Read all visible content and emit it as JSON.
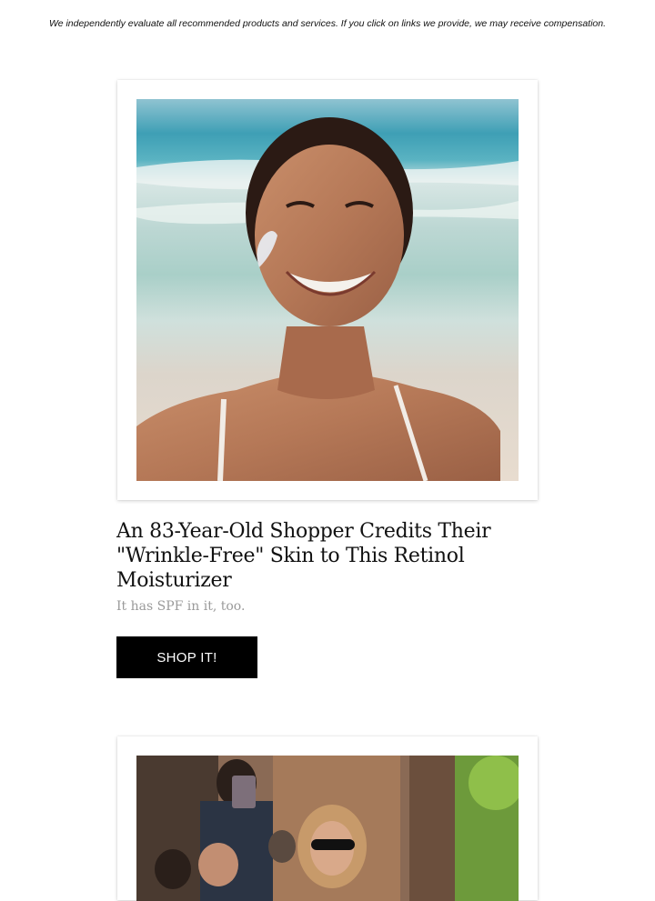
{
  "disclaimer": "We independently evaluate all recommended products and services. If you click on links we provide, we may receive compensation.",
  "articles": [
    {
      "headline": "An 83-Year-Old Shopper Credits Their \"Wrinkle-Free\" Skin to This Retinol Moisturizer",
      "subhead": "It has SPF in it, too.",
      "button_label": "SHOP IT!",
      "image_subject": "smiling woman at the beach with sunscreen on cheek"
    },
    {
      "image_subject": "woman in sunglasses surrounded by photographers on a city street"
    }
  ],
  "colors": {
    "button_bg": "#000000",
    "button_text": "#ffffff",
    "subhead": "#9a9a9a",
    "page_bg": "#ffffff"
  }
}
